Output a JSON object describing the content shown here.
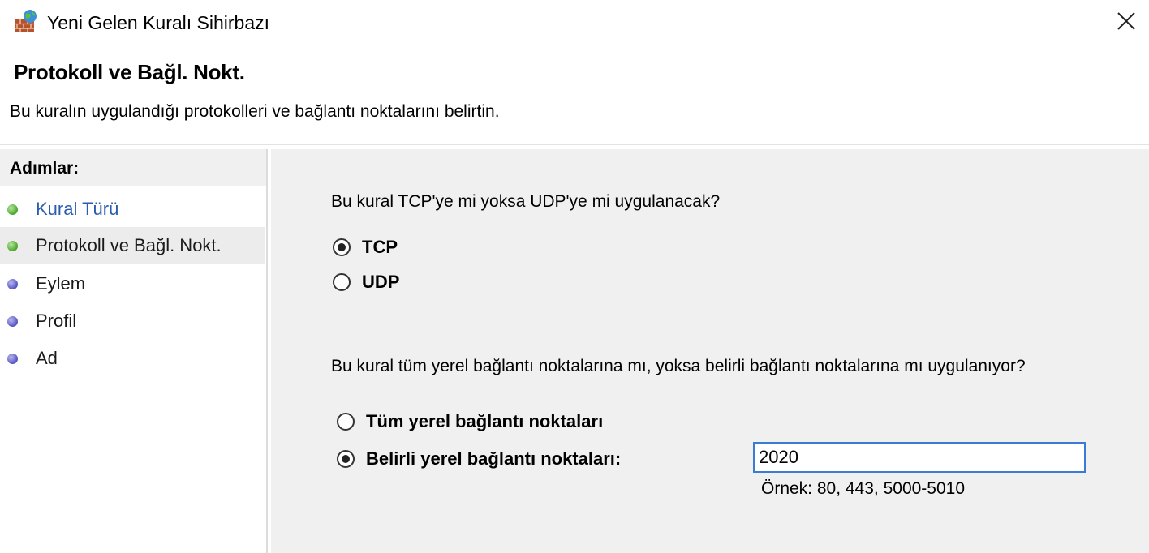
{
  "window": {
    "title": "Yeni Gelen Kuralı Sihirbazı",
    "close_icon": "close-icon",
    "app_icon": "firewall-icon"
  },
  "header": {
    "heading": "Protokoll ve Bağl. Nokt.",
    "subtitle": "Bu kuralın uygulandığı protokolleri ve bağlantı noktalarını belirtin."
  },
  "steps": {
    "title": "Adımlar:",
    "items": [
      {
        "label": "Kural Türü",
        "status": "completed",
        "dot_color": "#4aa52a"
      },
      {
        "label": "Protokoll ve Bağl. Nokt.",
        "status": "current",
        "dot_color": "#4aa52a"
      },
      {
        "label": "Eylem",
        "status": "pending",
        "dot_color": "#5553c4"
      },
      {
        "label": "Profil",
        "status": "pending",
        "dot_color": "#5553c4"
      },
      {
        "label": "Ad",
        "status": "pending",
        "dot_color": "#5553c4"
      }
    ]
  },
  "protocol": {
    "question": "Bu kural TCP'ye mi yoksa UDP'ye mi uygulanacak?",
    "options": [
      {
        "label": "TCP",
        "checked": true
      },
      {
        "label": "UDP",
        "checked": false
      }
    ]
  },
  "ports": {
    "question": "Bu kural tüm yerel bağlantı noktalarına mı, yoksa belirli bağlantı noktalarına mı uygulanıyor?",
    "options": [
      {
        "label": "Tüm yerel bağlantı noktaları",
        "checked": false
      },
      {
        "label": "Belirli yerel bağlantı noktaları:",
        "checked": true
      }
    ],
    "value": "2020",
    "example": "Örnek: 80, 443, 5000-5010"
  }
}
